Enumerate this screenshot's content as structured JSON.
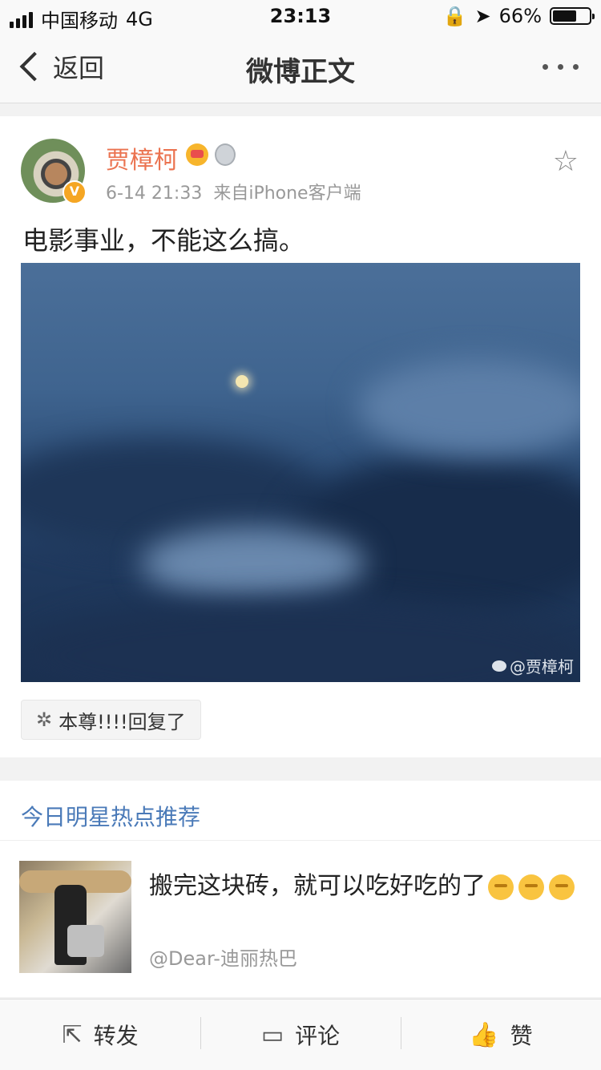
{
  "status_bar": {
    "carrier": "中国移动",
    "network": "4G",
    "time": "23:13",
    "battery": "66%",
    "battery_level": 0.66
  },
  "nav": {
    "back_label": "返回",
    "title": "微博正文"
  },
  "post": {
    "author": "贾樟柯",
    "verified_badge": "V",
    "time": "6-14 21:33",
    "source": "来自iPhone客户端",
    "text": "电影事业，不能这么搞。",
    "image_watermark": "@贾樟柯",
    "reply_chip": "本尊!!!!回复了"
  },
  "recommendation": {
    "section_title": "今日明星热点推荐",
    "item": {
      "text": "搬完这块砖，就可以吃好吃的了",
      "author": "@Dear-迪丽热巴"
    }
  },
  "toolbar": {
    "repost_label": "转发",
    "comment_label": "评论",
    "like_label": "赞"
  }
}
